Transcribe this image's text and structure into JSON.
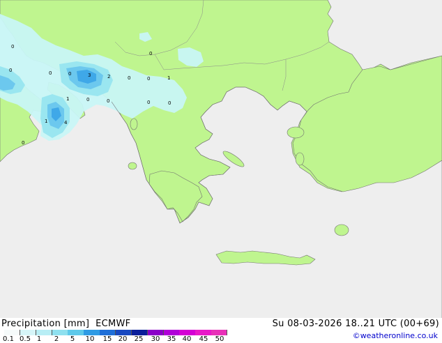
{
  "map": {
    "colors": {
      "sea": "#eeeeee",
      "land": "#bff58f",
      "precip_light": "#c8f5f5",
      "precip_mid": "#9ae6f0",
      "precip_heavy": "#6cc8ee",
      "precip_core": "#3fa8e8",
      "coast": "#707070",
      "border": "#8a8a8a"
    },
    "value_labels": [
      "0",
      "0",
      "0",
      "0",
      "0",
      "3",
      "2",
      "0",
      "0",
      "1",
      "0",
      "0",
      "1",
      "4",
      "0",
      "0",
      "0",
      "1"
    ]
  },
  "footer": {
    "title_left": "Precipitation [mm]  ECMWF",
    "title_right": "Su 08-03-2026 18..21 UTC (00+69)",
    "credit": "©weatheronline.co.uk",
    "scale_ticks": [
      "0.1",
      "0.5",
      "1",
      "2",
      "5",
      "10",
      "15",
      "20",
      "25",
      "30",
      "35",
      "40",
      "45",
      "50"
    ],
    "scale_colors": [
      "#f5fafa",
      "#d6f5f8",
      "#b8eef5",
      "#8ee0ef",
      "#5ec9ea",
      "#2f9be4",
      "#1f6fd8",
      "#1848c0",
      "#0a1e9a",
      "#8a00c8",
      "#b000d8",
      "#d400d4",
      "#e818c8",
      "#e830b8"
    ]
  }
}
